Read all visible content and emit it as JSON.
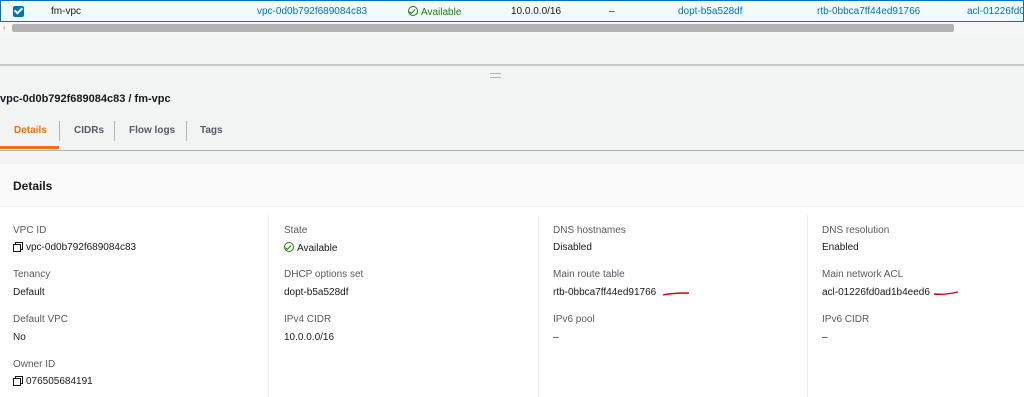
{
  "table_row": {
    "name": "fm-vpc",
    "vpc_id": "vpc-0d0b792f689084c83",
    "state": "Available",
    "ipv4_cidr": "10.0.0.0/16",
    "ipv6_cidr": "–",
    "dhcp_options": "dopt-b5a528df",
    "route_table": "rtb-0bbca7ff44ed91766",
    "network_acl": "acl-01226fd0"
  },
  "scrollbar": {
    "left_arrow": "‹"
  },
  "panel": {
    "title": "vpc-0d0b792f689084c83 / fm-vpc",
    "tabs": [
      {
        "label": "Details"
      },
      {
        "label": "CIDRs"
      },
      {
        "label": "Flow logs"
      },
      {
        "label": "Tags"
      }
    ]
  },
  "details": {
    "header": "Details",
    "fields": {
      "vpc_id": {
        "label": "VPC ID",
        "value": "vpc-0d0b792f689084c83"
      },
      "tenancy": {
        "label": "Tenancy",
        "value": "Default"
      },
      "default_vpc": {
        "label": "Default VPC",
        "value": "No"
      },
      "owner_id": {
        "label": "Owner ID",
        "value": "076505684191"
      },
      "state": {
        "label": "State",
        "value": "Available"
      },
      "dhcp_options": {
        "label": "DHCP options set",
        "value": "dopt-b5a528df"
      },
      "ipv4_cidr": {
        "label": "IPv4 CIDR",
        "value": "10.0.0.0/16"
      },
      "dns_hostnames": {
        "label": "DNS hostnames",
        "value": "Disabled"
      },
      "main_route_table": {
        "label": "Main route table",
        "value": "rtb-0bbca7ff44ed91766"
      },
      "ipv6_pool": {
        "label": "IPv6 pool",
        "value": "–"
      },
      "dns_resolution": {
        "label": "DNS resolution",
        "value": "Enabled"
      },
      "main_network_acl": {
        "label": "Main network ACL",
        "value": "acl-01226fd0ad1b4eed6"
      },
      "ipv6_cidr": {
        "label": "IPv6 CIDR",
        "value": "–"
      }
    }
  },
  "colors": {
    "link": "#0073bb",
    "active_tab": "#ec7211",
    "success": "#1d8102",
    "annotation": "#d0021b"
  },
  "icons": {
    "checkbox": "checkbox-checked-icon",
    "status": "check-circle-icon",
    "copy": "copy-icon",
    "resize_handle": "drag-handle-icon"
  }
}
